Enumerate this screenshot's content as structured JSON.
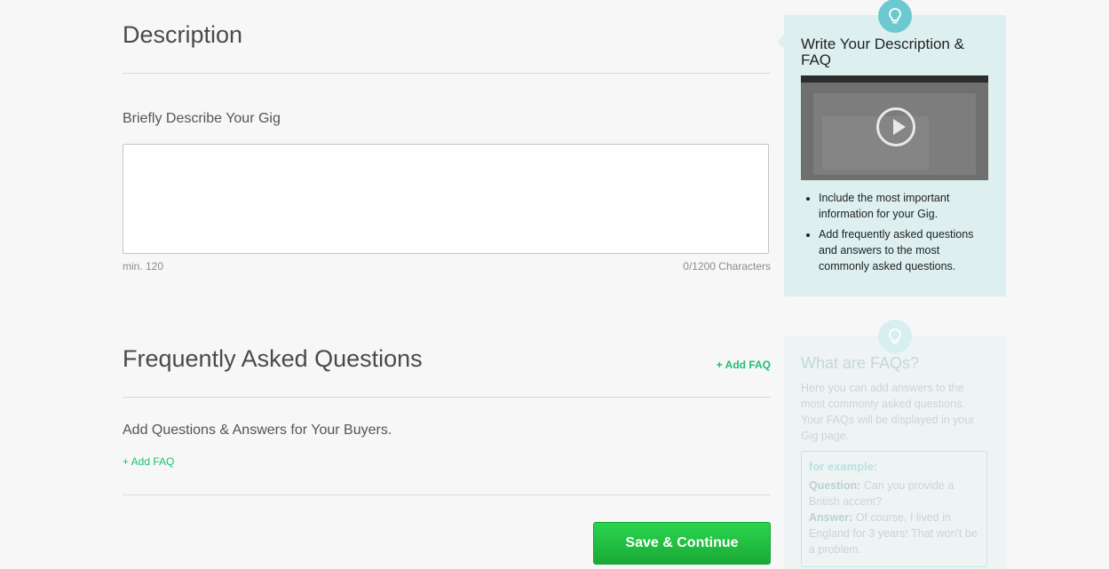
{
  "description": {
    "title": "Description",
    "field_label": "Briefly Describe Your Gig",
    "min_text": "min. 120",
    "char_count": "0/1200 Characters",
    "value": ""
  },
  "faq": {
    "title": "Frequently Asked Questions",
    "add_link_top": "+ Add FAQ",
    "subtitle": "Add Questions & Answers for Your Buyers.",
    "add_link": "+ Add FAQ"
  },
  "actions": {
    "save_label": "Save & Continue"
  },
  "sidebar": {
    "card1": {
      "title": "Write Your Description & FAQ",
      "tips": [
        "Include the most important information for your Gig.",
        "Add frequently asked questions and answers to the most commonly asked questions."
      ]
    },
    "card2": {
      "title": "What are FAQs?",
      "body": "Here you can add answers to the most commonly asked questions. Your FAQs will be displayed in your Gig page.",
      "example_heading": "for example:",
      "question_label": "Question:",
      "question_text": "Can you provide a British accent?",
      "answer_label": "Answer:",
      "answer_text": "Of course, I lived in England for 3 years! That won't be a problem."
    }
  },
  "colors": {
    "accent_green": "#1dbf73",
    "button_green": "#1dbf4a",
    "info_card_bg": "#ddefef",
    "bulb_teal": "#6cc9cf"
  },
  "icons": {
    "bulb": "lightbulb-icon",
    "video": "play-icon"
  }
}
